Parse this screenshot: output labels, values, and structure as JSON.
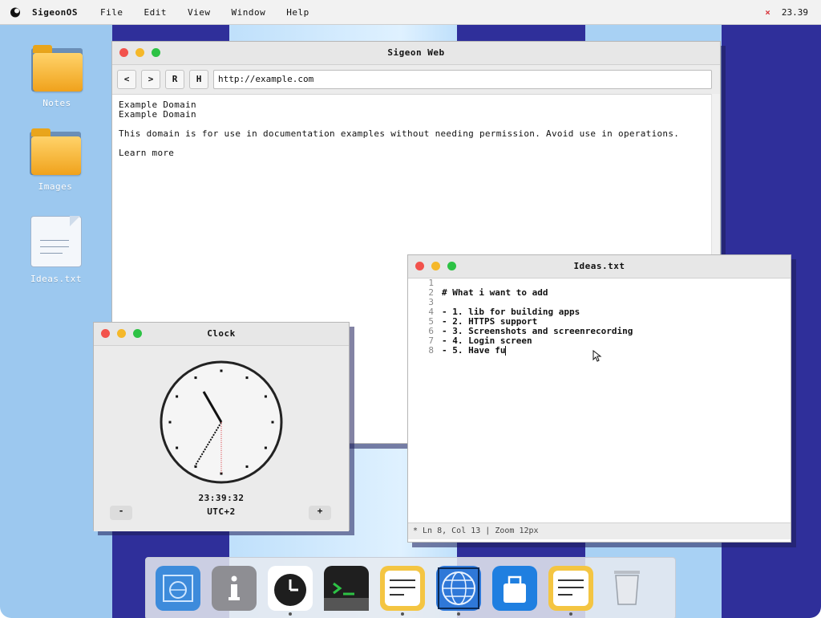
{
  "menubar": {
    "brand": "SigeonOS",
    "menus": [
      "File",
      "Edit",
      "View",
      "Window",
      "Help"
    ],
    "close_glyph": "×",
    "clock": "23.39"
  },
  "desktop_icons": [
    {
      "label": "Notes",
      "icon": "folder-icon"
    },
    {
      "label": "Images",
      "icon": "folder-icon"
    },
    {
      "label": "Ideas.txt",
      "icon": "text-file-icon"
    }
  ],
  "browser": {
    "title": "Sigeon Web",
    "nav": {
      "back": "<",
      "forward": ">",
      "reload": "R",
      "home": "H"
    },
    "url": "http://example.com",
    "content": {
      "line1": "Example Domain",
      "line2": "Example Domain",
      "para": "This domain is for use in documentation examples without needing permission. Avoid use in operations.",
      "link": "Learn more"
    }
  },
  "editor": {
    "title": "Ideas.txt",
    "lines": [
      {
        "num": "1",
        "text": ""
      },
      {
        "num": "2",
        "text": "# What i want to add"
      },
      {
        "num": "3",
        "text": ""
      },
      {
        "num": "4",
        "text": "- 1. lib for building apps"
      },
      {
        "num": "5",
        "text": "- 2. HTTPS support"
      },
      {
        "num": "6",
        "text": "- 3. Screenshots and screenrecording"
      },
      {
        "num": "7",
        "text": "- 4. Login screen"
      },
      {
        "num": "8",
        "text": "- 5. Have fu"
      }
    ],
    "status": "* Ln 8, Col 13 | Zoom 12px"
  },
  "clock": {
    "title": "Clock",
    "time": "23:39:32",
    "timezone": "UTC+2",
    "minus": "-",
    "plus": "+"
  },
  "dock": {
    "items": [
      {
        "name": "finder-icon",
        "color": "#3d8bdb",
        "running": false
      },
      {
        "name": "info-icon",
        "color": "#8e8e93",
        "running": false
      },
      {
        "name": "clock-icon",
        "color": "#ffffff",
        "running": true
      },
      {
        "name": "terminal-icon",
        "color": "#1f1f1f",
        "running": false
      },
      {
        "name": "notes-icon",
        "color": "#f4c542",
        "running": true
      },
      {
        "name": "browser-icon",
        "color": "#2f78d8",
        "running": true
      },
      {
        "name": "store-icon",
        "color": "#1f7fe0",
        "running": false
      },
      {
        "name": "text-editor-icon",
        "color": "#f4c542",
        "running": true
      },
      {
        "name": "trash-icon",
        "color": "#d9dde2",
        "running": false
      }
    ]
  }
}
